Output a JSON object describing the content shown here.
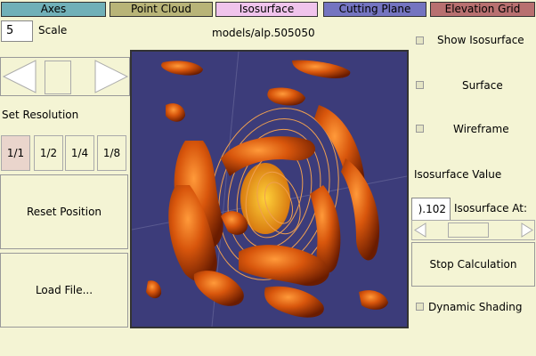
{
  "tabs": [
    {
      "label": "Axes",
      "color": "#70b0b8"
    },
    {
      "label": "Point Cloud",
      "color": "#b8b478"
    },
    {
      "label": "Isosurface",
      "color": "#f0c4ec"
    },
    {
      "label": "Cutting Plane",
      "color": "#7474c0"
    },
    {
      "label": "Elevation Grid",
      "color": "#b87070"
    }
  ],
  "scale": {
    "value": "5",
    "label": "Scale"
  },
  "model_path": "models/alp.505050",
  "resolution": {
    "label": "Set Resolution",
    "options": [
      "1/1",
      "1/2",
      "1/4",
      "1/8"
    ],
    "selected": "1/1"
  },
  "buttons": {
    "reset": "Reset Position",
    "load": "Load File...",
    "stop": "Stop Calculation"
  },
  "options": {
    "show_isosurface": "Show Isosurface",
    "surface": "Surface",
    "wireframe": "Wireframe",
    "dynamic_shading": "Dynamic Shading"
  },
  "isosurface": {
    "value_label": "Isosurface Value",
    "value": ").102",
    "at_label": "Isosurface At:"
  },
  "colors": {
    "background": "#f4f4d4",
    "viewport_bg": "#3c3c7a",
    "surface": "#d8560c",
    "contour": "#f0a050"
  }
}
